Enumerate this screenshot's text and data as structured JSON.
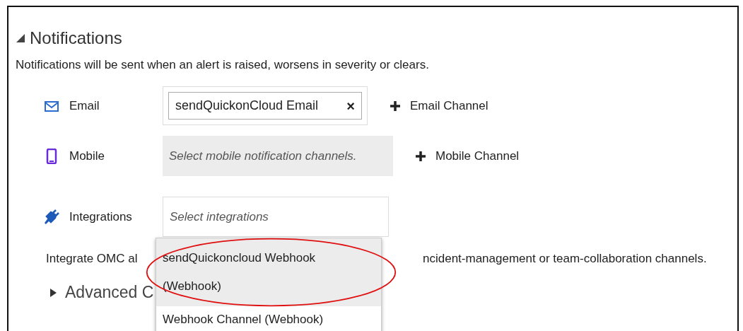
{
  "section": {
    "title": "Notifications",
    "expanded": true,
    "description": "Notifications will be sent when an alert is raised, worsens in severity or clears."
  },
  "channels": [
    {
      "kind": "email",
      "label": "Email",
      "chips": [
        {
          "label": "sendQuickonCloud Email",
          "remove": "×"
        }
      ],
      "add": "Email Channel"
    },
    {
      "kind": "mobile",
      "label": "Mobile",
      "placeholder": "Select mobile notification channels.",
      "add": "Mobile Channel"
    },
    {
      "kind": "integrations",
      "label": "Integrations",
      "placeholder": "Select integrations"
    }
  ],
  "dropdown": {
    "options": [
      {
        "label": "sendQuickoncloud Webhook (Webhook)",
        "selected": true
      },
      {
        "label": "Webhook Channel (Webhook)",
        "selected": false
      }
    ]
  },
  "integration_hint": {
    "before": "Integrate OMC al",
    "after": "ncident-management or team-collaboration channels."
  },
  "advanced": {
    "title": "Advanced C",
    "expanded": false
  }
}
